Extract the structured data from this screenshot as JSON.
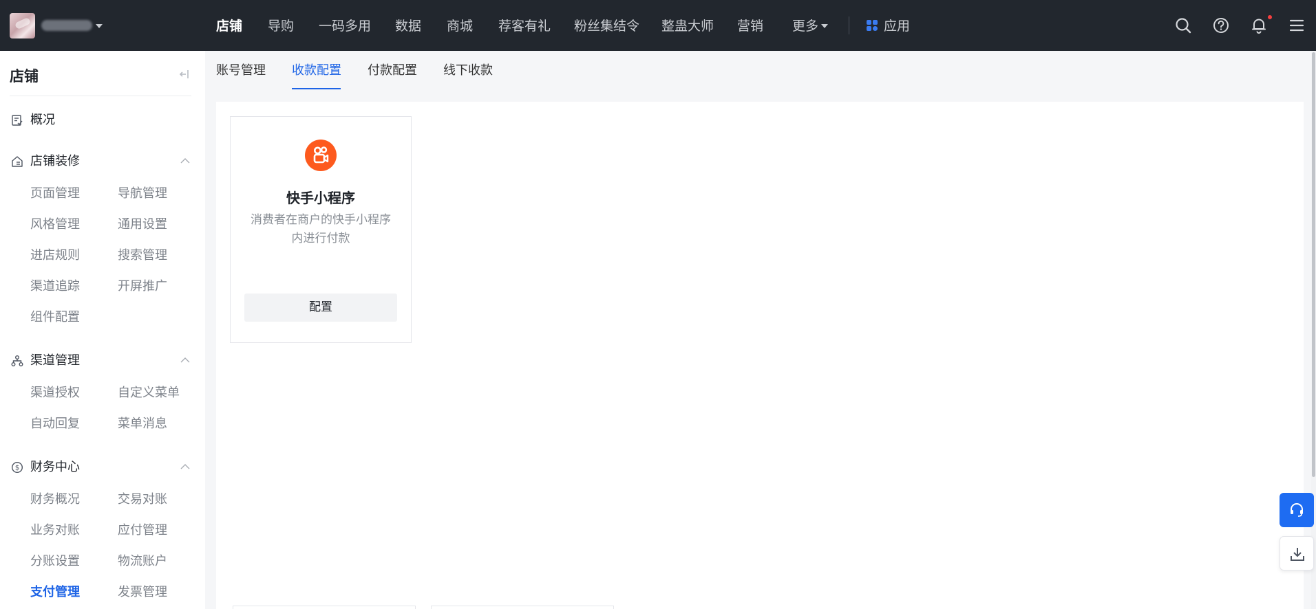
{
  "topnav": {
    "items": [
      {
        "label": "店铺",
        "active": true
      },
      {
        "label": "导购"
      },
      {
        "label": "一码多用"
      },
      {
        "label": "数据"
      },
      {
        "label": "商城"
      },
      {
        "label": "荐客有礼"
      },
      {
        "label": "粉丝集结令"
      },
      {
        "label": "整蛊大师"
      },
      {
        "label": "营销"
      },
      {
        "label": "更多"
      }
    ],
    "apps_label": "应用",
    "icons": [
      "search-icon",
      "help-icon",
      "bell-icon",
      "menu-icon"
    ]
  },
  "sidebar": {
    "title": "店铺",
    "overview": {
      "label": "概况",
      "icon": "overview-icon"
    },
    "groups": [
      {
        "label": "店铺装修",
        "icon": "store-decoration-icon",
        "items": [
          "页面管理",
          "导航管理",
          "风格管理",
          "通用设置",
          "进店规则",
          "搜索管理",
          "渠道追踪",
          "开屏推广",
          "组件配置"
        ]
      },
      {
        "label": "渠道管理",
        "icon": "channel-icon",
        "items": [
          "渠道授权",
          "自定义菜单",
          "自动回复",
          "菜单消息"
        ]
      },
      {
        "label": "财务中心",
        "icon": "finance-icon",
        "items": [
          "财务概况",
          "交易对账",
          "业务对账",
          "应付管理",
          "分账设置",
          "物流账户",
          "支付管理",
          "发票管理"
        ],
        "active_item": "支付管理"
      }
    ]
  },
  "tabs": {
    "items": [
      "账号管理",
      "收款配置",
      "付款配置",
      "线下收款"
    ],
    "active": "收款配置"
  },
  "card": {
    "icon": "kuaishou-icon",
    "title": "快手小程序",
    "desc_line1": "消费者在商户的快手小程序",
    "desc_line2": "内进行付款",
    "button": "配置"
  },
  "colors": {
    "topbar_bg": "#22272e",
    "accent": "#1e64e6",
    "kuaishou_orange": "#fd5a1e",
    "notification_dot": "#f53f3f"
  }
}
